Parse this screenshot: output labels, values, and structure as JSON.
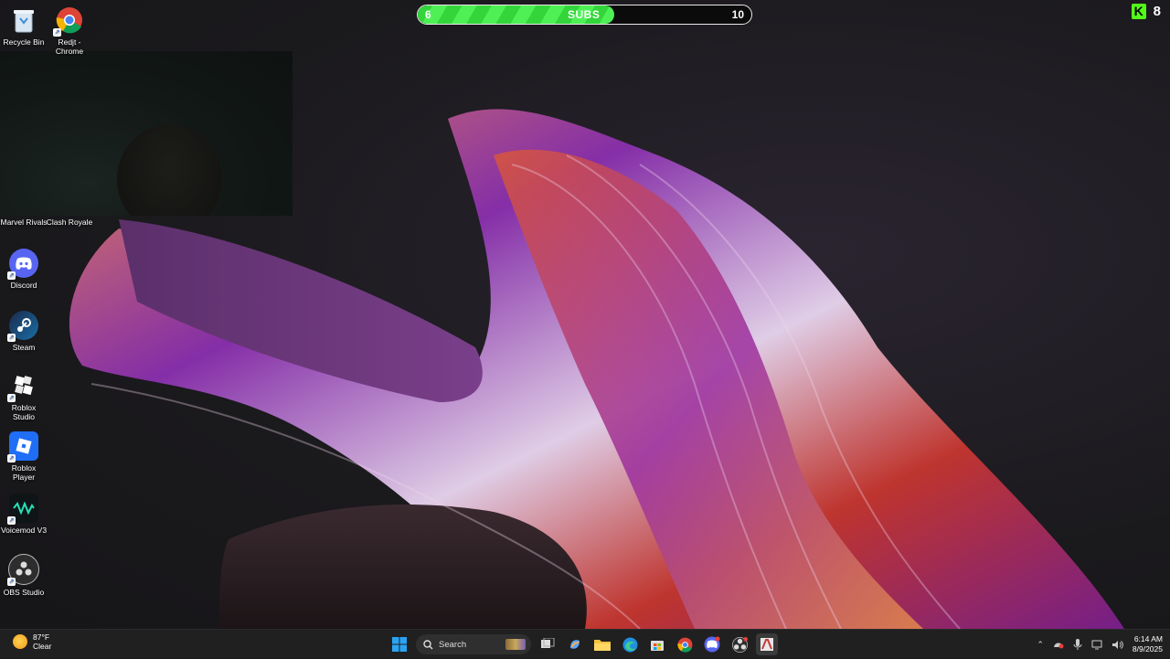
{
  "desktop": {
    "icons": [
      {
        "label": "Recycle Bin",
        "icon": "recycle-bin-icon"
      },
      {
        "label": "Redjt - Chrome",
        "icon": "chrome-icon"
      },
      {
        "label": "Marvel Rivals",
        "icon": "marvel-rivals-icon"
      },
      {
        "label": "Clash Royale",
        "icon": "clash-royale-icon"
      },
      {
        "label": "Discord",
        "icon": "discord-icon"
      },
      {
        "label": "Steam",
        "icon": "steam-icon"
      },
      {
        "label": "Roblox Studio",
        "icon": "roblox-studio-icon"
      },
      {
        "label": "Roblox Player",
        "icon": "roblox-player-icon"
      },
      {
        "label": "Voicemod V3",
        "icon": "voicemod-icon"
      },
      {
        "label": "OBS Studio",
        "icon": "obs-icon"
      }
    ]
  },
  "subs_goal": {
    "start": "6",
    "label": "SUBS",
    "goal": "10",
    "progress": 0.59,
    "fill_color": "#33d53b"
  },
  "kick": {
    "logo": "K",
    "count": "8",
    "color": "#53fc18"
  },
  "taskbar": {
    "weather_temp": "87°F",
    "weather_cond": "Clear",
    "search_placeholder": "Search",
    "apps": [
      "windows-start-icon",
      "task-view-icon",
      "copilot-icon",
      "file-explorer-icon",
      "edge-icon",
      "store-icon",
      "chrome-icon",
      "discord-icon",
      "obs-icon",
      "app-icon"
    ],
    "time": "6:14 AM",
    "date": "8/9/2025"
  }
}
